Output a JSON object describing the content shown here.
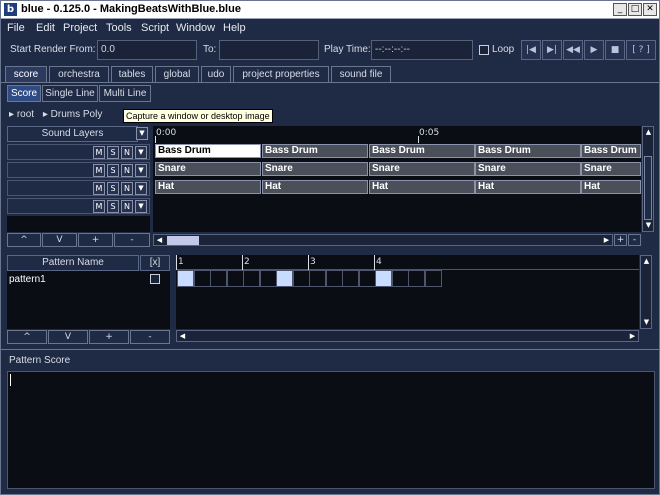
{
  "window": {
    "title": "blue - 0.125.0 - MakingBeatsWithBlue.blue",
    "icon_letter": "b"
  },
  "window_controls": {
    "minimize": "_",
    "maximize": "□",
    "close": "✕"
  },
  "menu": [
    "File",
    "Edit",
    "Project",
    "Tools",
    "Script",
    "Window",
    "Help"
  ],
  "render": {
    "start_label": "Start Render From:",
    "start_value": "0.0",
    "to_label": "To:",
    "to_value": "",
    "playtime_label": "Play Time:",
    "playtime_value": "--:--:--:--",
    "loop_label": "Loop",
    "help_label": "[ ? ]"
  },
  "tabs": [
    "score",
    "orchestra",
    "tables",
    "global",
    "udo",
    "project properties",
    "sound file"
  ],
  "subtabs": [
    "Score",
    "Single Line",
    "Multi Line"
  ],
  "breadcrumb": {
    "root": "root",
    "child": "Drums Poly"
  },
  "tooltip": "Capture a window or desktop image",
  "sound_layers": {
    "header": "Sound Layers",
    "buttons": {
      "m": "M",
      "s": "S",
      "n": "N"
    },
    "footer": [
      "^",
      "V",
      "+",
      "-"
    ]
  },
  "timeline": {
    "marks": [
      "0:00",
      "0:05"
    ]
  },
  "score_rows": [
    [
      "Bass Drum",
      "Bass Drum",
      "Bass Drum",
      "Bass Drum",
      "Bass Drum"
    ],
    [
      "Snare",
      "Snare",
      "Snare",
      "Snare",
      "Snare"
    ],
    [
      "Hat",
      "Hat",
      "Hat",
      "Hat",
      "Hat"
    ]
  ],
  "pattern_scroll": {
    "plus": "+",
    "minus": "-"
  },
  "patterns": {
    "header_name": "Pattern Name",
    "header_mute": "[x]",
    "rows": [
      {
        "name": "pattern1",
        "muted": false
      }
    ],
    "footer": [
      "^",
      "V",
      "+",
      "-"
    ],
    "beats": [
      "1",
      "2",
      "3",
      "4"
    ],
    "steps_on": [
      1,
      0,
      0,
      0,
      0,
      0,
      1,
      0,
      0,
      0,
      0,
      0,
      1,
      0,
      0,
      0
    ]
  },
  "pattern_score": {
    "header": "Pattern Score",
    "text": ""
  }
}
